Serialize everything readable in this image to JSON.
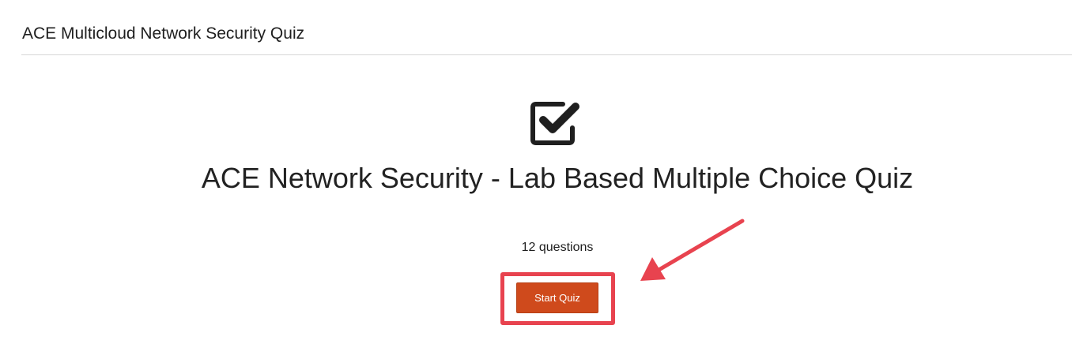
{
  "header": {
    "title": "ACE Multicloud Network Security Quiz"
  },
  "quiz": {
    "icon": "checkbox-checked-icon",
    "title": "ACE Network Security - Lab Based Multiple Choice Quiz",
    "question_count_label": "12 questions",
    "start_button_label": "Start Quiz"
  },
  "annotation": {
    "highlight_color": "#e8434f",
    "arrow_icon": "arrow-pointer-icon"
  },
  "colors": {
    "button": "#cf4a1c",
    "divider": "#d6d6d6",
    "text": "#222222"
  }
}
